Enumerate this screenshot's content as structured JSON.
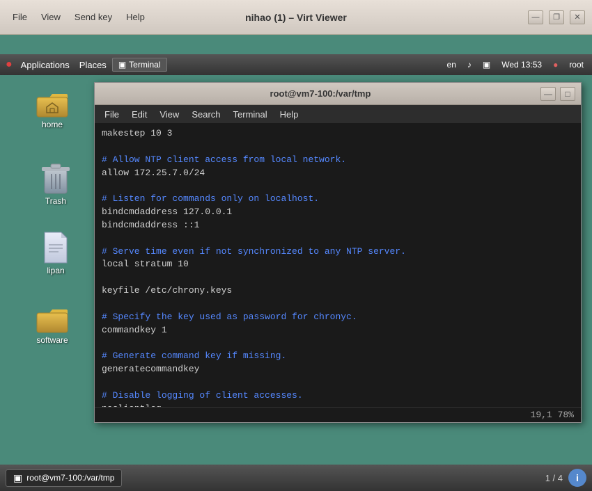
{
  "window": {
    "title": "nihao (1) – Virt Viewer",
    "menu": {
      "items": [
        "File",
        "View",
        "Send key",
        "Help"
      ]
    },
    "controls": {
      "minimize": "—",
      "restore": "❐",
      "close": "✕"
    }
  },
  "top_panel": {
    "foot_icon": "●",
    "apps_label": "Applications",
    "places_label": "Places",
    "terminal_tab_icon": "▣",
    "terminal_tab_label": "Terminal",
    "lang": "en",
    "volume_icon": "♪",
    "monitor_icon": "▣",
    "datetime": "Wed 13:53",
    "user_icon": "●",
    "user": "root"
  },
  "desktop_icons": [
    {
      "id": "home",
      "label": "home",
      "type": "folder"
    },
    {
      "id": "trash",
      "label": "Trash",
      "type": "trash"
    },
    {
      "id": "lipan",
      "label": "lipan",
      "type": "file"
    },
    {
      "id": "software",
      "label": "software",
      "type": "folder"
    }
  ],
  "terminal": {
    "title": "root@vm7-100:/var/tmp",
    "menu_items": [
      "File",
      "Edit",
      "View",
      "Search",
      "Terminal",
      "Help"
    ],
    "content_lines": [
      {
        "text": "makestep 10 3",
        "class": "t-normal"
      },
      {
        "text": "",
        "class": "t-normal"
      },
      {
        "text": "# Allow NTP client access from local network.",
        "class": "t-comment"
      },
      {
        "text": "allow 172.25.7.0/24",
        "class": "t-normal"
      },
      {
        "text": "",
        "class": "t-normal"
      },
      {
        "text": "# Listen for commands only on localhost.",
        "class": "t-comment"
      },
      {
        "text": "bindcmdaddress 127.0.0.1",
        "class": "t-normal"
      },
      {
        "text": "bindcmdaddress ::1",
        "class": "t-normal"
      },
      {
        "text": "",
        "class": "t-normal"
      },
      {
        "text": "# Serve time even if not synchronized to any NTP server.",
        "class": "t-comment"
      },
      {
        "text": "local stratum 10",
        "class": "t-normal"
      },
      {
        "text": "",
        "class": "t-normal"
      },
      {
        "text": "keyfile /etc/chrony.keys",
        "class": "t-normal"
      },
      {
        "text": "",
        "class": "t-normal"
      },
      {
        "text": "# Specify the key used as password for chronyc.",
        "class": "t-comment"
      },
      {
        "text": "commandkey 1",
        "class": "t-normal"
      },
      {
        "text": "",
        "class": "t-normal"
      },
      {
        "text": "# Generate command key if missing.",
        "class": "t-comment"
      },
      {
        "text": "generatecommandkey",
        "class": "t-normal"
      },
      {
        "text": "",
        "class": "t-normal"
      },
      {
        "text": "# Disable logging of client accesses.",
        "class": "t-comment"
      },
      {
        "text": "noclientlog",
        "class": "t-normal"
      }
    ],
    "status": "19,1          78%",
    "minimize": "—",
    "maximize": "□"
  },
  "bottom_panel": {
    "taskbar_icon": "▣",
    "taskbar_label": "root@vm7-100:/var/tmp",
    "page_indicator": "1 / 4",
    "info_icon": "i"
  }
}
